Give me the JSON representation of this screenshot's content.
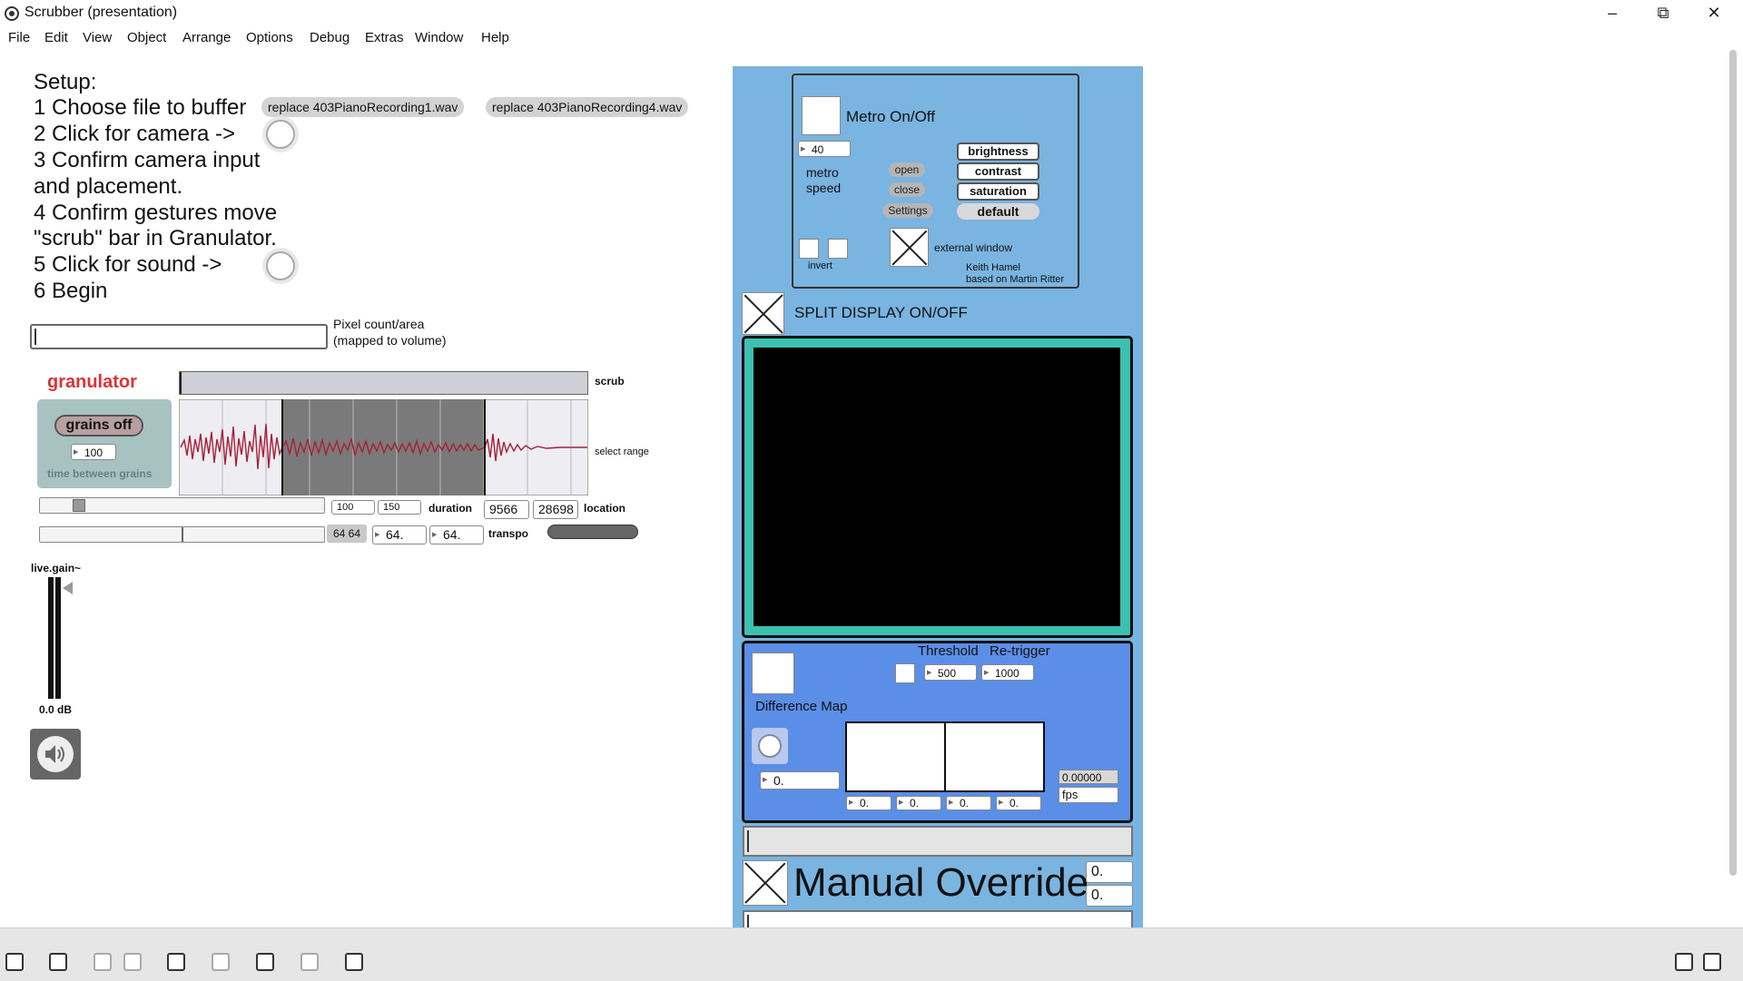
{
  "window": {
    "title": "Scrubber (presentation)",
    "controls": {
      "minimize": "–",
      "restore": "⧉",
      "close": "✕"
    }
  },
  "menu": [
    "File",
    "Edit",
    "View",
    "Object",
    "Arrange",
    "Options",
    "Debug",
    "Extras",
    "Window",
    "Help"
  ],
  "setup": {
    "heading": "Setup:",
    "step1": "1 Choose file to buffer",
    "step2": "2 Click for camera ->",
    "step3a": "3 Confirm camera input",
    "step3b": "and placement.",
    "step4a": "4 Confirm gestures move",
    "step4b": "\"scrub\" bar in Granulator.",
    "step5": "5 Click for sound ->",
    "step6": "6 Begin",
    "file_button_1": "replace 403PianoRecording1.wav",
    "file_button_2": "replace 403PianoRecording4.wav"
  },
  "pixel": {
    "label_1": "Pixel count/area",
    "label_2": "(mapped to volume)"
  },
  "granulator": {
    "title": "granulator",
    "grains_button": "grains off",
    "time_value": "100",
    "time_label": "time between grains",
    "scrub_label": "scrub",
    "select_range_label": "select range",
    "duration_min": "100",
    "duration_max": "150",
    "duration_label": "duration",
    "location_start": "9566",
    "location_end": "28698",
    "location_label": "location",
    "transpo_pair": "64 64",
    "transpo_1": "64.",
    "transpo_2": "64.",
    "transpo_label": "transpo",
    "duration_slider_value": 0.12,
    "transpo_slider_value": 0.5
  },
  "gain": {
    "label": "live.gain~",
    "value": "0.0 dB"
  },
  "metro": {
    "label": "Metro On/Off",
    "speed_value": "40",
    "speed_label_1": "metro",
    "speed_label_2": "speed",
    "open": "open",
    "close": "close",
    "settings": "Settings",
    "brightness": "brightness",
    "contrast": "contrast",
    "saturation": "saturation",
    "default": "default",
    "invert": "invert",
    "external_window": "external window",
    "credit_1": "Keith Hamel",
    "credit_2": "based on Martin Ritter"
  },
  "split_display": {
    "label": "SPLIT DISPLAY ON/OFF"
  },
  "difference": {
    "threshold_label": "Threshold",
    "retrigger_label": "Re-trigger",
    "threshold_value": "500",
    "retrigger_value": "1000",
    "map_label": "Difference Map",
    "value": "0.",
    "grid_values": [
      "0.",
      "0.",
      "0.",
      "0."
    ],
    "fps_value": "0.00000",
    "fps_label": "fps"
  },
  "override": {
    "label": "Manual Override",
    "value_1": "0.",
    "value_2": "0."
  },
  "colors": {
    "panel_blue": "#7ab4e0",
    "difference_blue": "#5b8ee6",
    "display_teal": "#3cc0b0",
    "granulator_red": "#d93535",
    "waveform_red": "#a8203a"
  }
}
